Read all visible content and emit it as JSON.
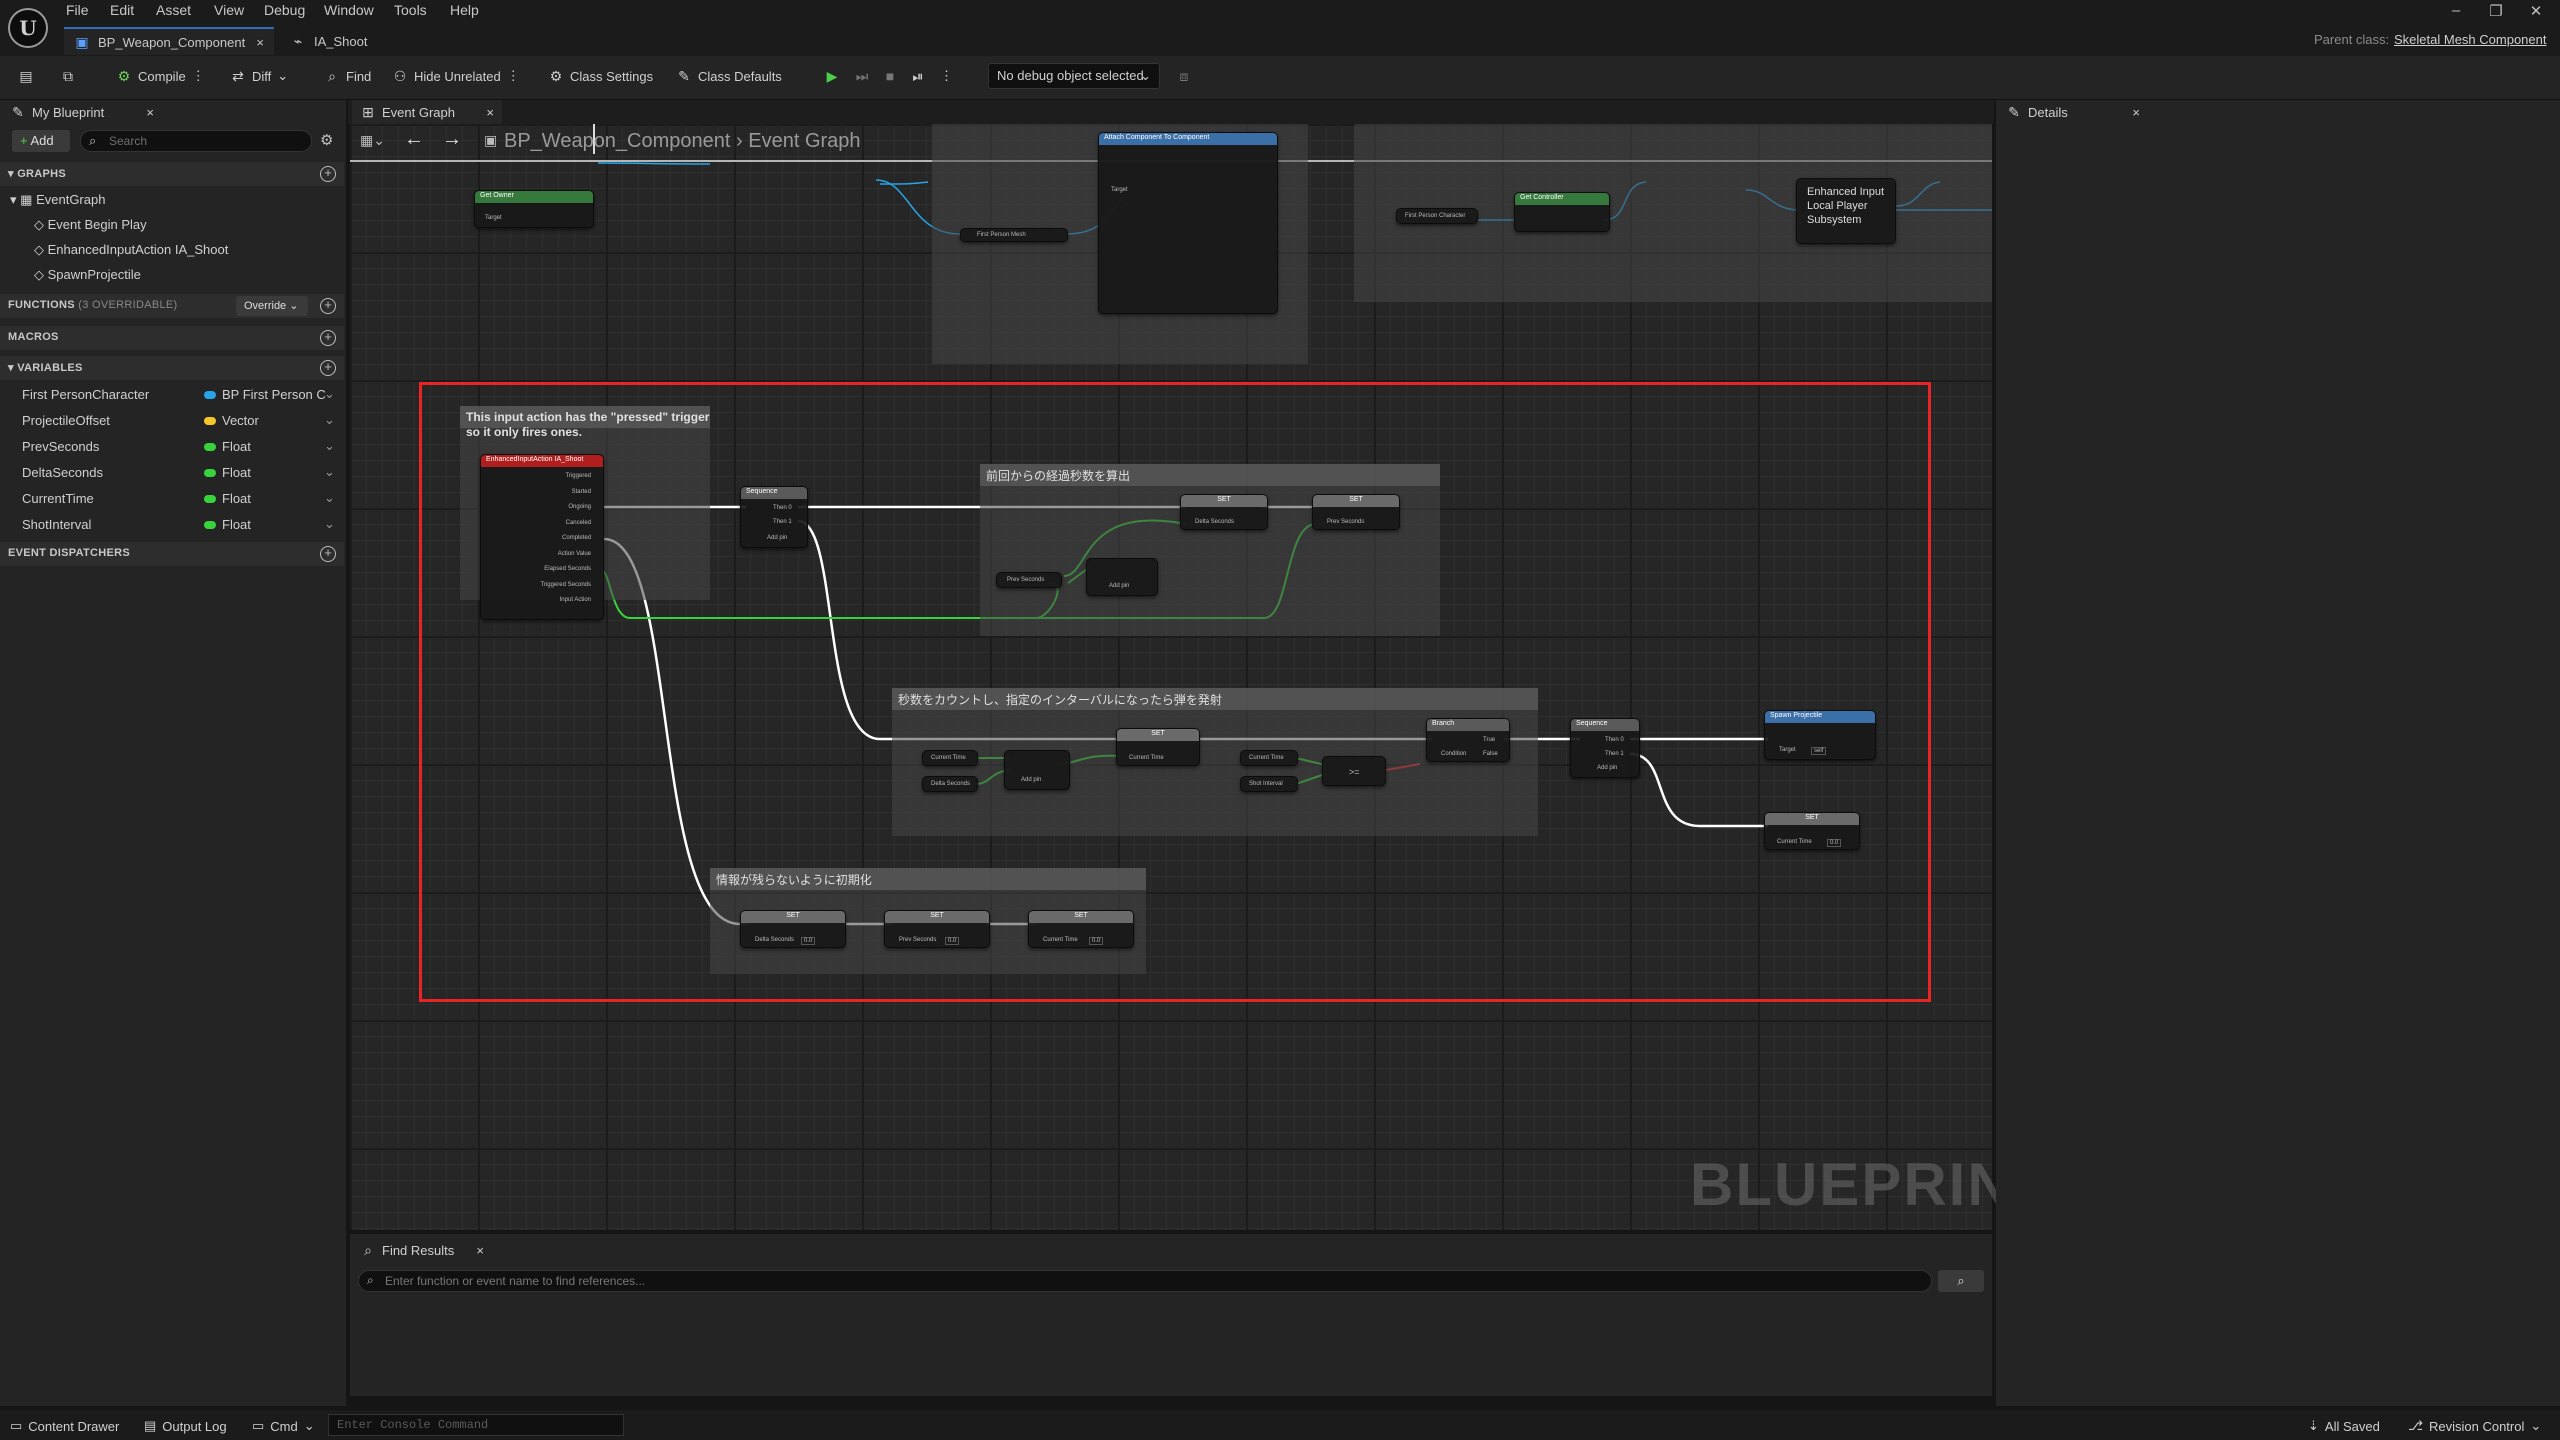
{
  "menu": [
    "File",
    "Edit",
    "Asset",
    "View",
    "Debug",
    "Window",
    "Tools",
    "Help"
  ],
  "tabs": [
    {
      "label": "BP_Weapon_Component"
    },
    {
      "label": "IA_Shoot"
    }
  ],
  "parent_class": {
    "label": "Parent class:",
    "value": "Skeletal Mesh Component"
  },
  "toolbar": {
    "compile": "Compile",
    "diff": "Diff",
    "find": "Find",
    "hide_unrelated": "Hide Unrelated",
    "class_settings": "Class Settings",
    "class_defaults": "Class Defaults",
    "debug_object": "No debug object selected"
  },
  "my_blueprint": {
    "tab": "My Blueprint",
    "add": "Add",
    "search_placeholder": "Search",
    "graphs_header": "GRAPHS",
    "graphs": [
      "EventGraph",
      "Event Begin Play",
      "EnhancedInputAction IA_Shoot",
      "SpawnProjectile"
    ],
    "functions_header": "FUNCTIONS",
    "functions_count": "(3 OVERRIDABLE)",
    "override": "Override",
    "macros_header": "MACROS",
    "variables_header": "VARIABLES",
    "variables": [
      {
        "name": "First PersonCharacter",
        "type": "BP First Person C",
        "color": "#27a3e8"
      },
      {
        "name": "ProjectileOffset",
        "type": "Vector",
        "color": "#f7c62a"
      },
      {
        "name": "PrevSeconds",
        "type": "Float",
        "color": "#37d23c"
      },
      {
        "name": "DeltaSeconds",
        "type": "Float",
        "color": "#37d23c"
      },
      {
        "name": "CurrentTime",
        "type": "Float",
        "color": "#37d23c"
      },
      {
        "name": "ShotInterval",
        "type": "Float",
        "color": "#37d23c"
      }
    ],
    "dispatchers_header": "EVENT DISPATCHERS"
  },
  "event_graph": {
    "tab": "Event Graph",
    "breadcrumb_root": "BP_Weapon_Component",
    "breadcrumb_leaf": "Event Graph",
    "watermark": "BLUEPRINT",
    "comment_input": "This input action has the \"pressed\" trigger\nso it only fires ones.",
    "comment_delta": "前回からの経過秒数を算出",
    "comment_count": "秒数をカウントし、指定のインターバルになったら弾を発射",
    "comment_reset": "情報が残らないように初期化",
    "nodes": {
      "input_action": "EnhancedInputAction IA_Shoot",
      "input_pins": [
        "Triggered",
        "Started",
        "Ongoing",
        "Canceled",
        "Completed",
        "Action Value",
        "Elapsed Seconds",
        "Triggered Seconds",
        "Input Action"
      ],
      "sequence": "Sequence",
      "then0": "Then 0",
      "then1": "Then 1",
      "add_pin": "Add pin",
      "set": "SET",
      "delta_seconds": "Delta Seconds",
      "prev_seconds": "Prev Seconds",
      "current_time": "Current Time",
      "shot_interval": "Shot Interval",
      "gte": ">=",
      "branch": "Branch",
      "condition": "Condition",
      "true": "True",
      "false": "False",
      "spawn_projectile": "Spawn Projectile",
      "target": "Target",
      "self": "self",
      "zero": "0.0",
      "enhanced_input": "Enhanced Input Local Player Subsystem",
      "get_owner": "Get Owner",
      "get_controller": "Get Controller",
      "first_person_character": "First Person Character",
      "first_person_mesh": "First Person Mesh",
      "attach": "Attach Component To Component"
    }
  },
  "details": {
    "tab": "Details"
  },
  "find_results": {
    "tab": "Find Results",
    "placeholder": "Enter function or event name to find references..."
  },
  "status": {
    "content_drawer": "Content Drawer",
    "output_log": "Output Log",
    "cmd": "Cmd",
    "console_placeholder": "Enter Console Command",
    "all_saved": "All Saved",
    "revision_control": "Revision Control"
  }
}
